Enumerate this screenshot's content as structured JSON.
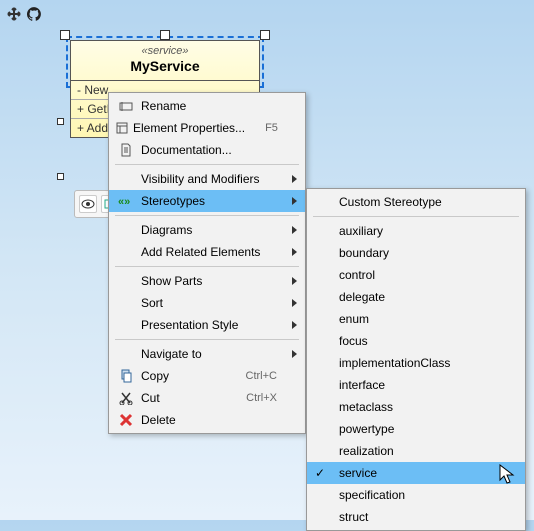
{
  "uml": {
    "stereotype": "«service»",
    "name": "MyService",
    "rows": [
      "- New",
      "+ GetI",
      "+ Add"
    ]
  },
  "menu_main": {
    "items": [
      {
        "icon": "rename-icon",
        "label": "Rename"
      },
      {
        "icon": "properties-icon",
        "label": "Element Properties...",
        "shortcut": "F5"
      },
      {
        "icon": "doc-icon",
        "label": "Documentation..."
      },
      {
        "sep": true
      },
      {
        "label": "Visibility and Modifiers",
        "arrow": true
      },
      {
        "icon": "stereo-icon",
        "label": "Stereotypes",
        "arrow": true,
        "selected": true
      },
      {
        "sep": true
      },
      {
        "label": "Diagrams",
        "arrow": true
      },
      {
        "label": "Add Related Elements",
        "arrow": true
      },
      {
        "sep": true
      },
      {
        "label": "Show Parts",
        "arrow": true
      },
      {
        "label": "Sort",
        "arrow": true
      },
      {
        "label": "Presentation Style",
        "arrow": true
      },
      {
        "sep": true
      },
      {
        "label": "Navigate to",
        "arrow": true
      },
      {
        "icon": "copy-icon",
        "label": "Copy",
        "shortcut": "Ctrl+C"
      },
      {
        "icon": "cut-icon",
        "label": "Cut",
        "shortcut": "Ctrl+X"
      },
      {
        "icon": "delete-icon",
        "label": "Delete"
      }
    ]
  },
  "menu_sub": {
    "items": [
      {
        "label": "Custom Stereotype"
      },
      {
        "sep": true
      },
      {
        "label": "auxiliary"
      },
      {
        "label": "boundary"
      },
      {
        "label": "control"
      },
      {
        "label": "delegate"
      },
      {
        "label": "enum"
      },
      {
        "label": "focus"
      },
      {
        "label": "implementationClass"
      },
      {
        "label": "interface"
      },
      {
        "label": "metaclass"
      },
      {
        "label": "powertype"
      },
      {
        "label": "realization"
      },
      {
        "label": "service",
        "checked": true,
        "selected": true
      },
      {
        "label": "specification"
      },
      {
        "label": "struct"
      }
    ]
  }
}
